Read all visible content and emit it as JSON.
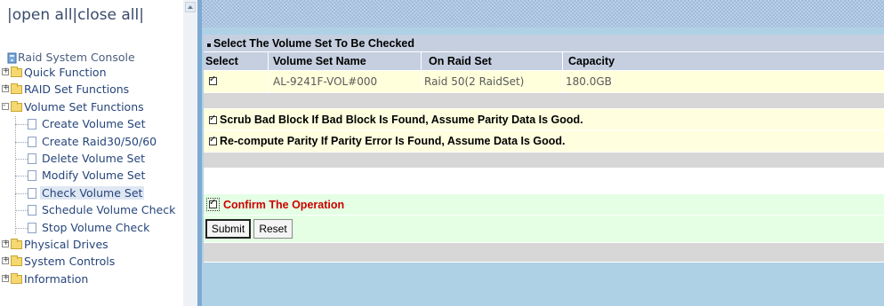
{
  "left": {
    "top_links": "|open all|close all|",
    "console_title": "Raid System Console",
    "tree": [
      {
        "label": "Quick Function",
        "type": "folder",
        "expander": "+"
      },
      {
        "label": "RAID Set Functions",
        "type": "folder",
        "expander": "+"
      },
      {
        "label": "Volume Set Functions",
        "type": "folder",
        "expander": "-"
      },
      {
        "label": "Create Volume Set",
        "type": "doc"
      },
      {
        "label": "Create Raid30/50/60",
        "type": "doc"
      },
      {
        "label": "Delete Volume Set",
        "type": "doc"
      },
      {
        "label": "Modify Volume Set",
        "type": "doc"
      },
      {
        "label": "Check Volume Set",
        "type": "doc",
        "selected": true
      },
      {
        "label": "Schedule Volume Check",
        "type": "doc"
      },
      {
        "label": "Stop Volume Check",
        "type": "doc"
      },
      {
        "label": "Physical Drives",
        "type": "folder",
        "expander": "+"
      },
      {
        "label": "System Controls",
        "type": "folder",
        "expander": "+"
      },
      {
        "label": "Information",
        "type": "folder",
        "expander": "+"
      }
    ]
  },
  "main": {
    "section_title": "Select The Volume Set To Be Checked",
    "columns": [
      "Select",
      "Volume Set Name",
      "On Raid Set",
      "Capacity"
    ],
    "rows": [
      {
        "selected": true,
        "name": "AL-9241F-VOL#000",
        "raid_set": "Raid 50(2 RaidSet)",
        "capacity": "180.0GB"
      }
    ],
    "options": [
      {
        "checked": true,
        "label": "Scrub Bad Block If Bad Block Is Found, Assume Parity Data Is Good."
      },
      {
        "checked": true,
        "label": "Re-compute Parity If Parity Error Is Found, Assume Data Is Good."
      }
    ],
    "confirm": {
      "checked": true,
      "label": "Confirm The Operation"
    },
    "buttons": {
      "submit": "Submit",
      "reset": "Reset"
    }
  },
  "colors": {
    "header_row": "#c5cfe0",
    "data_row": "#ffffdc",
    "option_row": "#ffffe0",
    "confirm_row": "#e4ffe4",
    "gray_band": "#d7d7d7",
    "confirm_text": "#cc0000",
    "right_bg": "#aed1e6"
  }
}
